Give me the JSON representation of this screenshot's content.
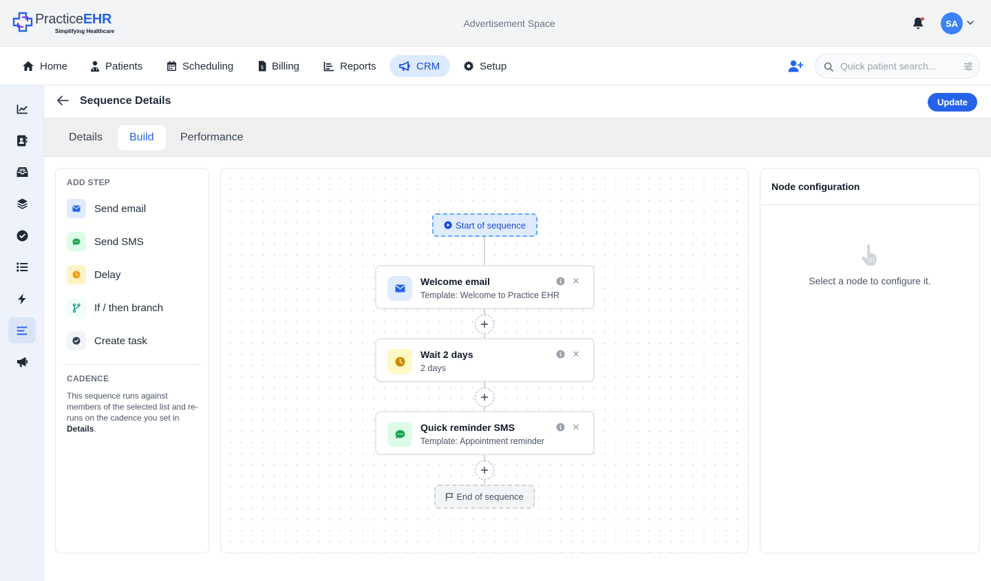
{
  "app": {
    "logo_prefix": "Practice",
    "logo_brand": "EHR",
    "logo_tagline": "Simplifying Healthcare",
    "ad_space": "Advertisement Space",
    "user_initials": "SA",
    "brand_color": "#2563eb"
  },
  "nav": {
    "items": [
      {
        "label": "Home",
        "icon": "home-icon"
      },
      {
        "label": "Patients",
        "icon": "patients-icon"
      },
      {
        "label": "Scheduling",
        "icon": "calendar-icon"
      },
      {
        "label": "Billing",
        "icon": "billing-icon"
      },
      {
        "label": "Reports",
        "icon": "reports-icon"
      },
      {
        "label": "CRM",
        "icon": "megaphone-icon",
        "active": true
      },
      {
        "label": "Setup",
        "icon": "gear-icon"
      }
    ],
    "search_placeholder": "Quick patient search..."
  },
  "sidebar": {
    "icons": [
      "analytics-icon",
      "contacts-icon",
      "inbox-icon",
      "layers-icon",
      "check-circle-icon",
      "list-icon",
      "bolt-icon",
      "sequence-icon",
      "megaphone-icon"
    ],
    "active_index": 7
  },
  "header": {
    "title": "Sequence Details",
    "update_label": "Update"
  },
  "tabs": [
    {
      "label": "Details"
    },
    {
      "label": "Build",
      "active": true
    },
    {
      "label": "Performance"
    }
  ],
  "add_step": {
    "heading": "ADD STEP",
    "items": [
      {
        "label": "Send email",
        "icon": "envelope-icon"
      },
      {
        "label": "Send SMS",
        "icon": "sms-icon"
      },
      {
        "label": "Delay",
        "icon": "clock-icon"
      },
      {
        "label": "If / then branch",
        "icon": "branch-icon"
      },
      {
        "label": "Create task",
        "icon": "check-circle-icon"
      }
    ],
    "cadence_heading": "CADENCE",
    "cadence_text": "This sequence runs against members of the selected list and re-runs on the cadence you set in ",
    "cadence_link": "Details",
    "cadence_suffix": "."
  },
  "flow": {
    "start_label": "Start of sequence",
    "end_label": "End of sequence",
    "nodes": [
      {
        "title": "Welcome email",
        "subtitle": "Template: Welcome to Practice EHR",
        "icon": "envelope-icon"
      },
      {
        "title": "Wait 2 days",
        "subtitle": "2 days",
        "icon": "clock-icon"
      },
      {
        "title": "Quick reminder SMS",
        "subtitle": "Template: Appointment reminder",
        "icon": "sms-icon"
      }
    ]
  },
  "config": {
    "title": "Node configuration",
    "empty_text": "Select a node to configure it."
  }
}
